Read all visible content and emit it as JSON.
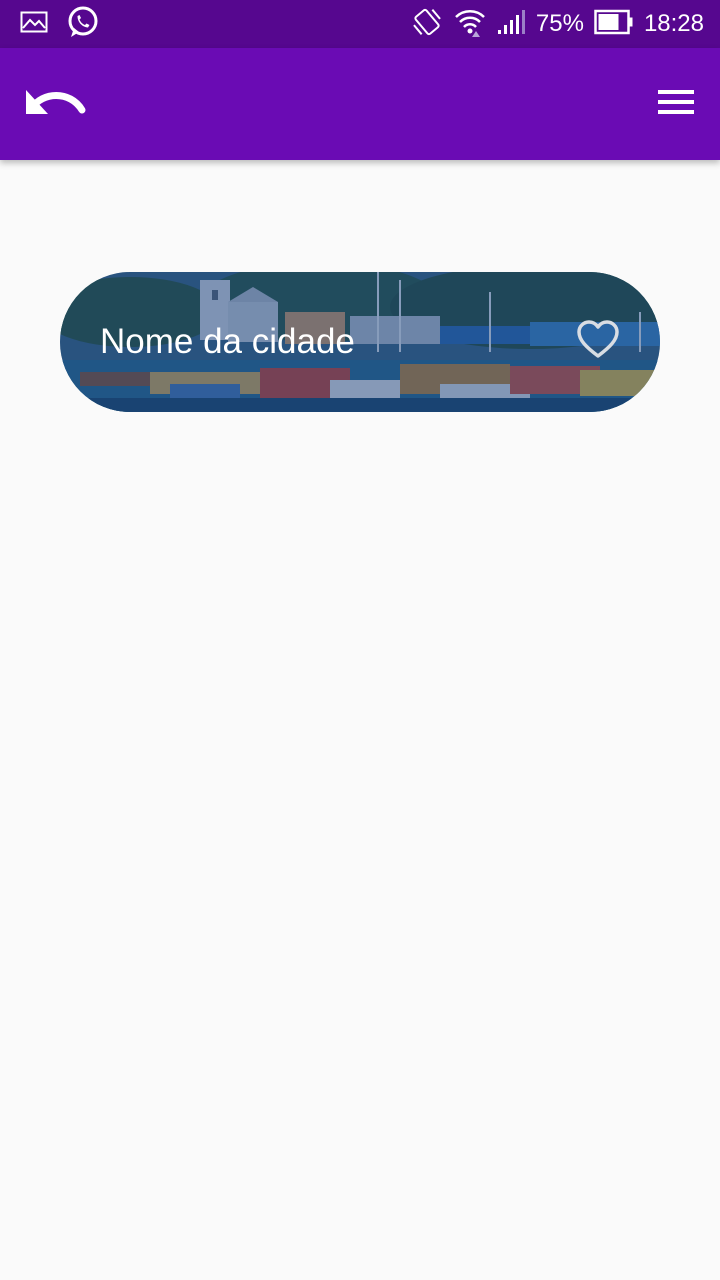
{
  "status_bar": {
    "battery_percent": "75%",
    "time": "18:28",
    "icons": [
      "gallery-icon",
      "whatsapp-icon",
      "vibrate-icon",
      "wifi-icon",
      "signal-icon",
      "battery-icon"
    ]
  },
  "app_bar": {
    "back_icon": "undo-arrow-icon",
    "menu_icon": "hamburger-menu-icon",
    "color": "#6a0bb4"
  },
  "city_card": {
    "name": "Nome da cidade",
    "favorite_icon": "heart-outline-icon"
  },
  "colors": {
    "status_bar": "#56078f",
    "app_bar": "#6a0bb4",
    "background": "#fafafa",
    "card_text": "#ffffff"
  }
}
